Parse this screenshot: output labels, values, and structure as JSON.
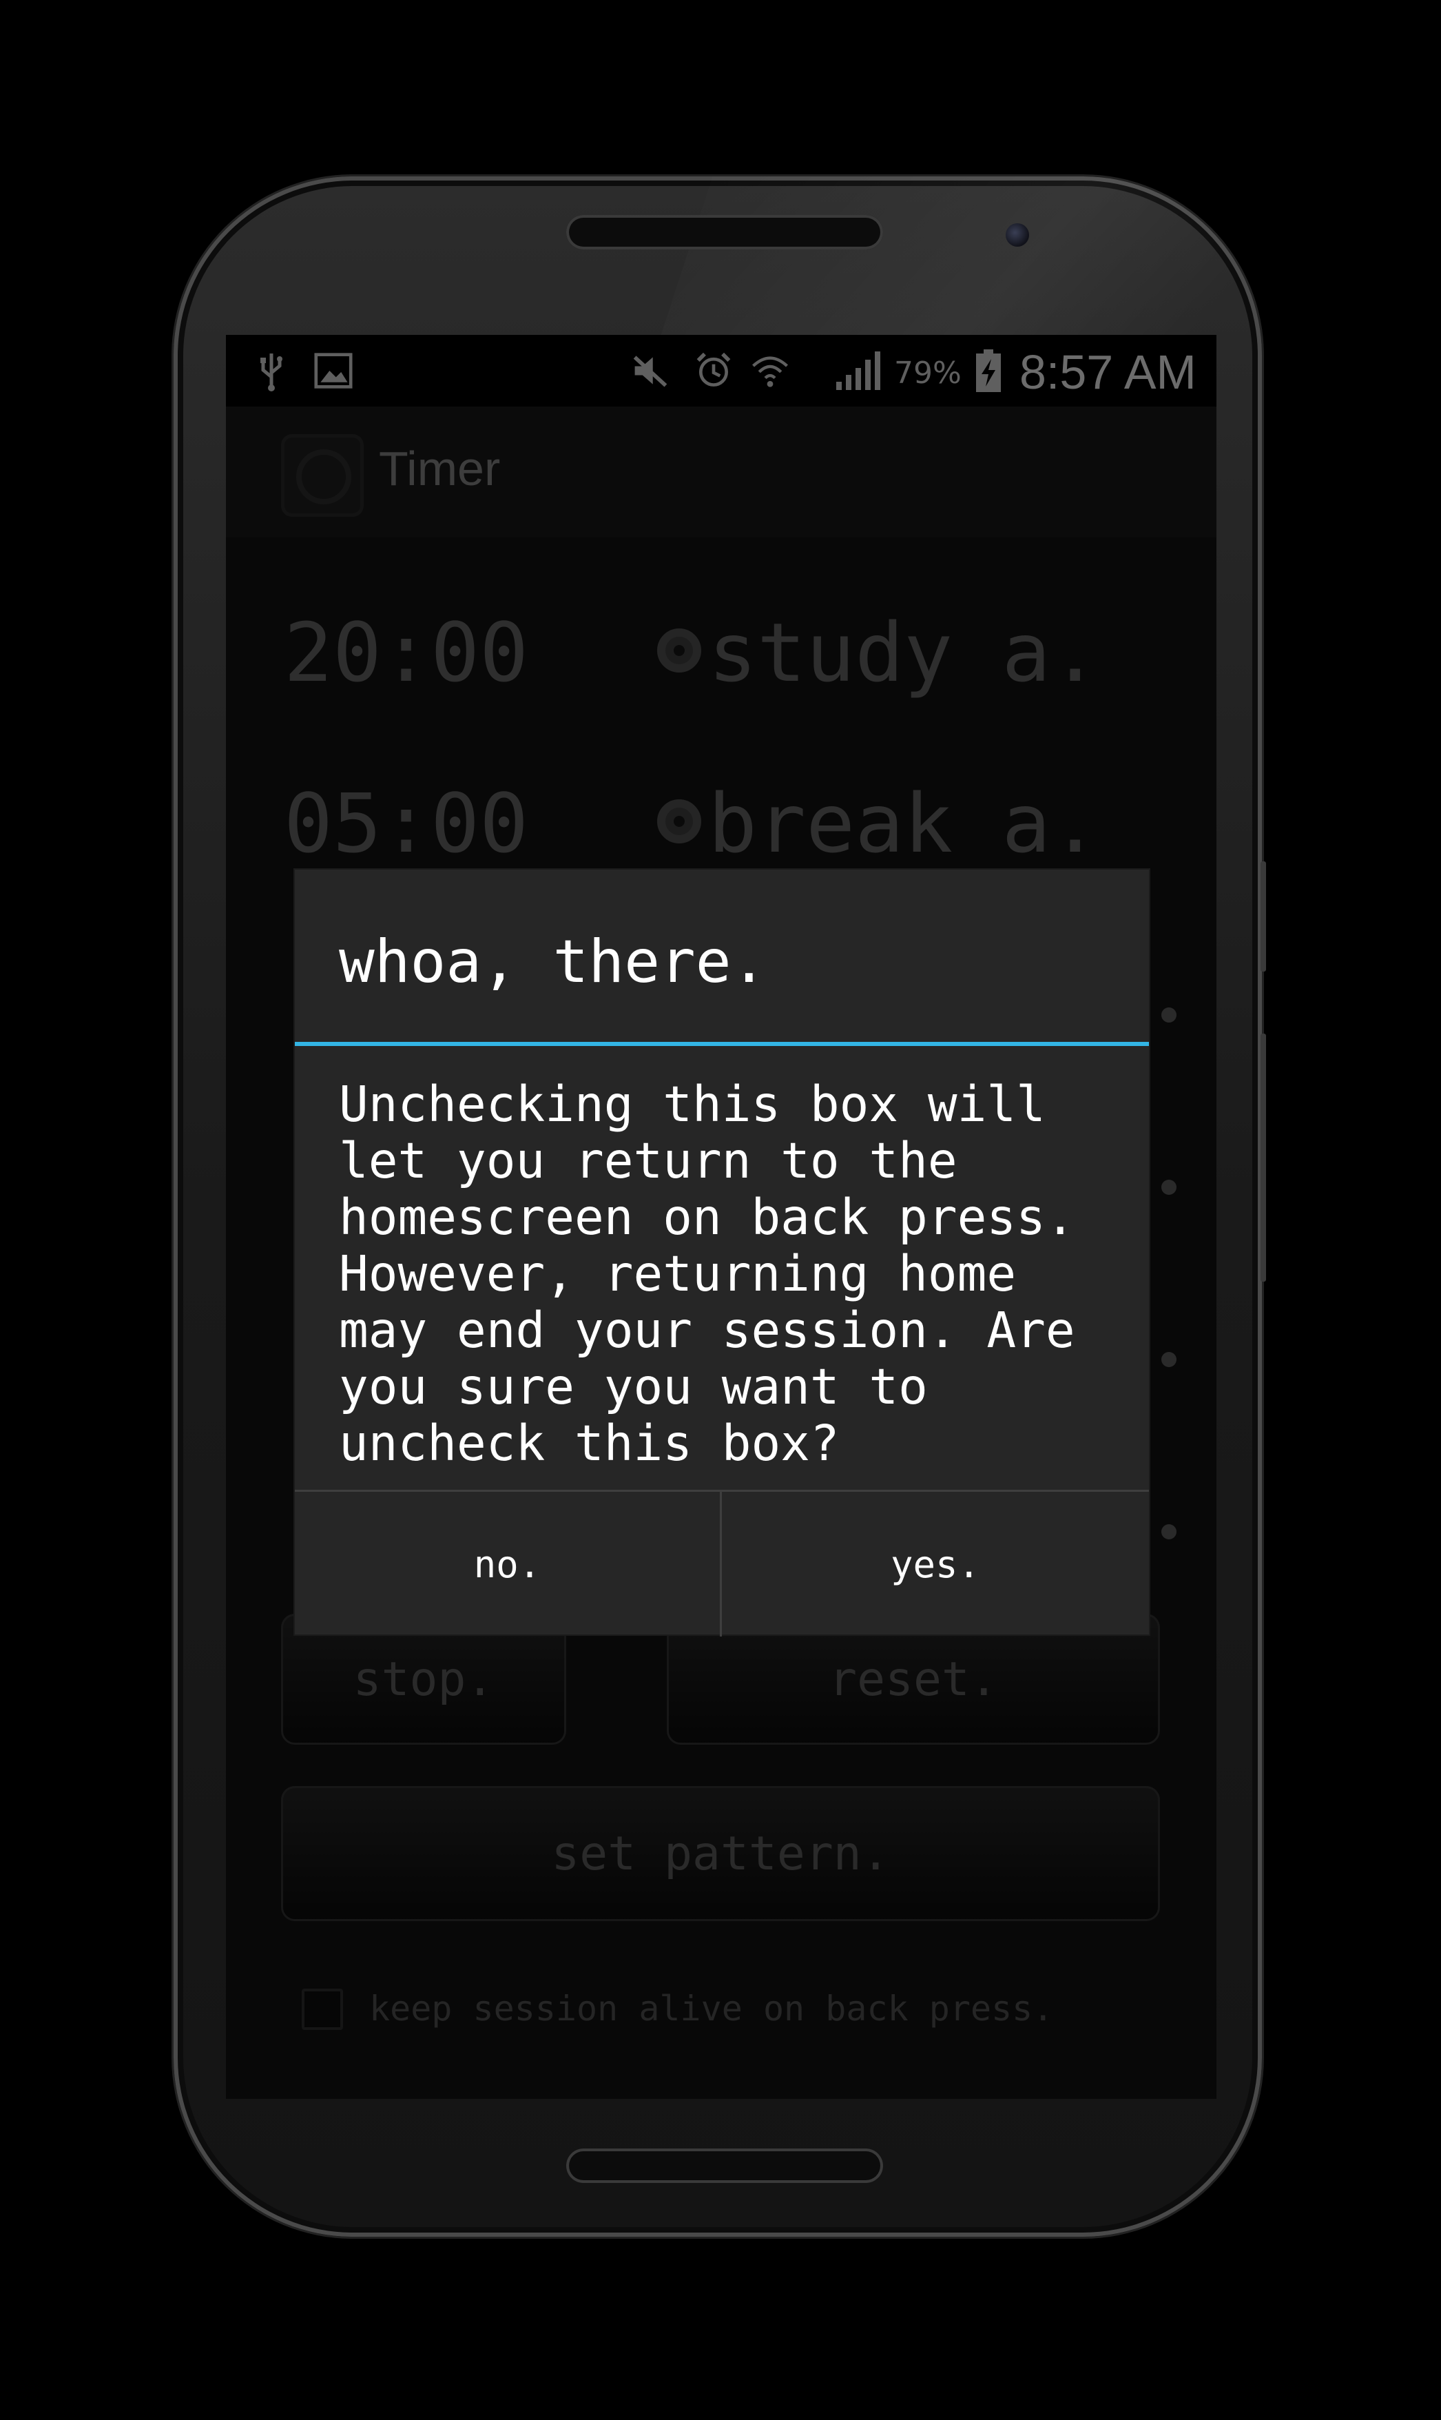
{
  "status_bar": {
    "icons": [
      "usb-icon",
      "image-icon",
      "mute-icon",
      "alarm-icon",
      "wifi-icon",
      "signal-icon",
      "battery-charging-icon"
    ],
    "battery_percent": "79%",
    "time": "8:57 AM"
  },
  "action_bar": {
    "title": "Timer",
    "logo": "timer-app-icon"
  },
  "timers": [
    {
      "duration": "20:00",
      "label": "study a."
    },
    {
      "duration": "05:00",
      "label": "break a."
    }
  ],
  "buttons": {
    "stop": "stop.",
    "reset": "reset.",
    "set_pattern": "set pattern."
  },
  "keep_alive": {
    "label": "keep session alive on back press.",
    "checked": false
  },
  "dialog": {
    "title": "whoa, there.",
    "message": "Unchecking this box will\nlet you return to the\nhomescreen on back press.\nHowever, returning home\nmay end your session. Are\nyou sure you want to\nuncheck this box?",
    "no_label": "no.",
    "yes_label": "yes.",
    "accent_color": "#33b5e5"
  }
}
